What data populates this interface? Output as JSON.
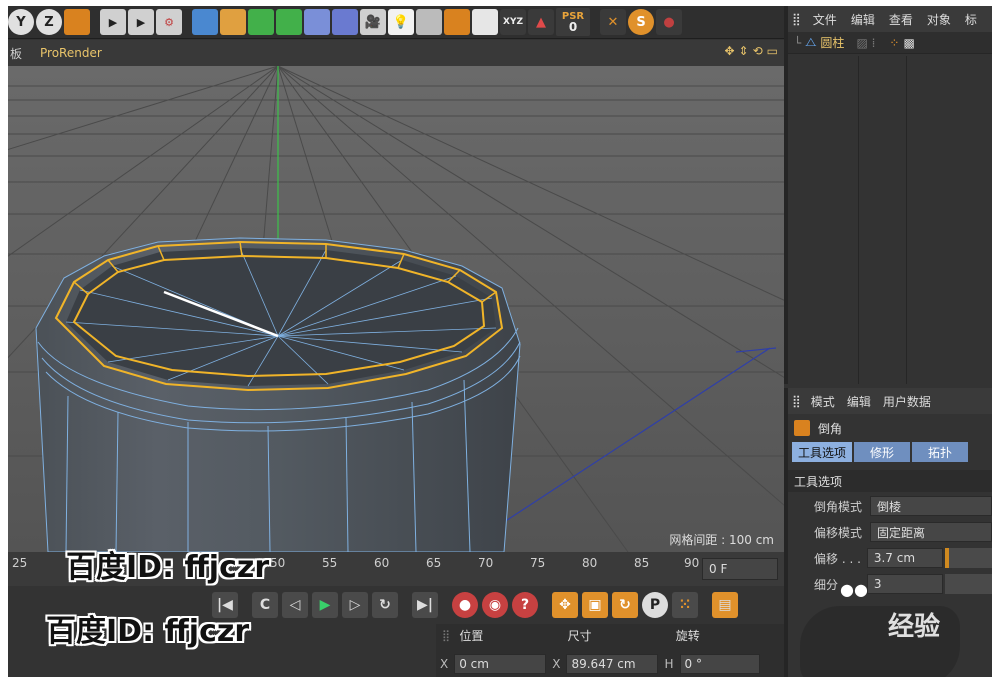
{
  "toolbar": {
    "buttons": [
      "Y",
      "Z",
      "coordinate-system",
      "render-view",
      "render-picture",
      "edit-render-settings",
      "cube",
      "pen",
      "subdivision",
      "cloner",
      "deformer",
      "floor",
      "camera",
      "light",
      "joint",
      "tag",
      "xpresso",
      "axis-xyz",
      "warning"
    ],
    "psr_label": "PSR",
    "psr_value": "0"
  },
  "viewport_menu": {
    "item_cut": "板",
    "prorender": "ProRender"
  },
  "viewport": {
    "grid_spacing": "网格间距 : 100 cm"
  },
  "object_manager": {
    "menu": [
      "文件",
      "编辑",
      "查看",
      "对象",
      "标"
    ],
    "object_name": "圆柱"
  },
  "attribute_manager": {
    "menu": [
      "模式",
      "编辑",
      "用户数据"
    ],
    "tool_name": "倒角",
    "tabs": [
      "工具选项",
      "修形",
      "拓扑"
    ],
    "section_title": "工具选项",
    "fields": [
      {
        "label": "倒角模式",
        "value": "倒棱"
      },
      {
        "label": "偏移模式",
        "value": "固定距离"
      },
      {
        "label": "偏移 . . .",
        "value": "3.7 cm"
      },
      {
        "label": "细分",
        "value": "3"
      }
    ],
    "offset_slider_fraction": 0.08
  },
  "timeline": {
    "ticks": [
      "25",
      "50",
      "55",
      "60",
      "65",
      "70",
      "75",
      "80",
      "85",
      "90"
    ],
    "current_frame": "0 F"
  },
  "coordinates": {
    "headers": [
      "位置",
      "尺寸",
      "旋转"
    ],
    "x_label": "X",
    "position_x": "0 cm",
    "size_x_label": "X",
    "size_x": "89.647 cm",
    "rotation_h_label": "H",
    "rotation_h": "0 °"
  },
  "watermarks": {
    "baidu_top": "百度ID: ffjczr",
    "baidu_bottom": "百度ID: ffjczr",
    "jingyan": "经验"
  },
  "colors": {
    "accent_yellow": "#e9c46a",
    "selection_orange": "#f0b429",
    "wire_blue": "#7fb0e0",
    "tab_blue": "#6f8fbf"
  }
}
